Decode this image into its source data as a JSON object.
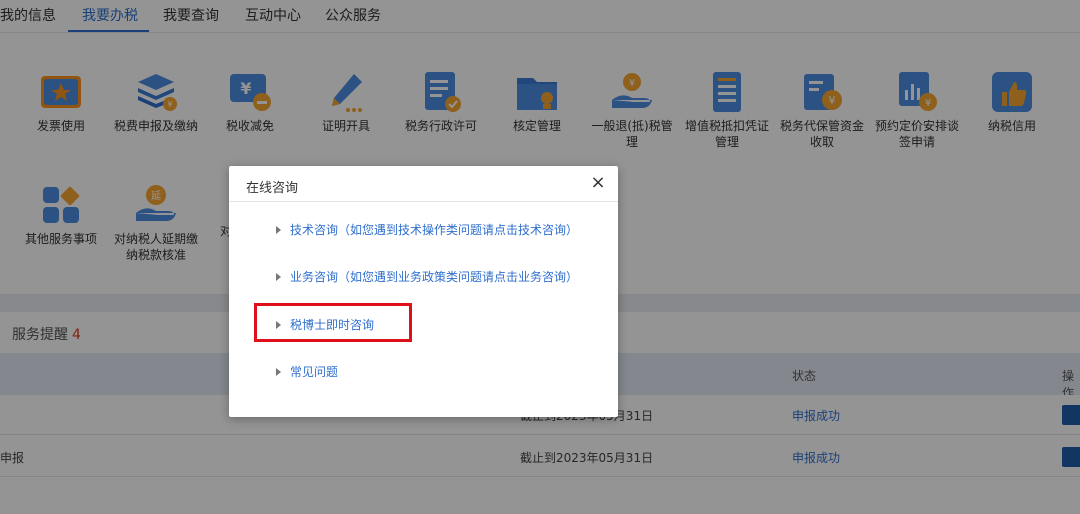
{
  "nav": {
    "tabs": [
      "我的信息",
      "我要办税",
      "我要查询",
      "互动中心",
      "公众服务"
    ],
    "active_index": 1
  },
  "services": [
    {
      "label": "发票使用",
      "icon": "invoice-icon"
    },
    {
      "label": "税费申报及缴纳",
      "icon": "tax-declare-icon"
    },
    {
      "label": "税收减免",
      "icon": "tax-reduction-icon"
    },
    {
      "label": "证明开具",
      "icon": "certificate-pen-icon"
    },
    {
      "label": "税务行政许可",
      "icon": "admin-permit-icon"
    },
    {
      "label": "核定管理",
      "icon": "assessment-folder-icon"
    },
    {
      "label": "一般退(抵)税管理",
      "icon": "refund-hand-icon"
    },
    {
      "label": "增值税抵扣凭证管理",
      "icon": "vat-voucher-icon"
    },
    {
      "label": "税务代保管资金收取",
      "icon": "custody-funds-icon"
    },
    {
      "label": "预约定价安排谈签申请",
      "icon": "pricing-chart-icon"
    },
    {
      "label": "纳税信用",
      "icon": "credit-thumb-icon"
    },
    {
      "label": "其他服务事项",
      "icon": "other-services-icon"
    },
    {
      "label": "对纳税人延期缴纳税款核准",
      "icon": "deferral-icon"
    },
    {
      "label": "对",
      "icon": "partial-icon"
    }
  ],
  "reminder": {
    "title": "服务提醒",
    "count": "4"
  },
  "table": {
    "headers": {
      "status": "状态",
      "op": "操作"
    },
    "rows": [
      {
        "name": "",
        "deadline": "截止到2023年05月31日",
        "status": "申报成功"
      },
      {
        "name": "申报",
        "deadline": "截止到2023年05月31日",
        "status": "申报成功"
      }
    ]
  },
  "modal": {
    "title": "在线咨询",
    "close": "×",
    "items": [
      "技术咨询（如您遇到技术操作类问题请点击技术咨询）",
      "业务咨询（如您遇到业务政策类问题请点击业务咨询）",
      "税博士即时咨询",
      "常见问题"
    ]
  },
  "colors": {
    "accent": "#2f6fce",
    "highlight": "#e0101a",
    "reminder_count": "#e03a1e"
  }
}
